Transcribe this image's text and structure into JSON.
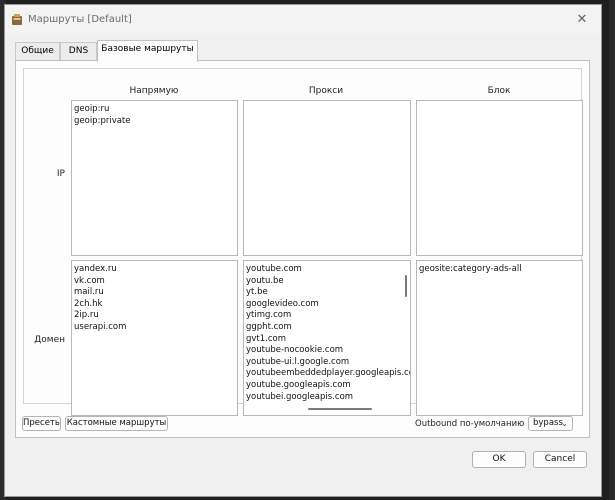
{
  "window": {
    "title": "Маршруты [Default]"
  },
  "tabs": [
    {
      "label": "Общие"
    },
    {
      "label": "DNS"
    },
    {
      "label": "Базовые маршруты"
    }
  ],
  "columns": {
    "direct": "Напрямую",
    "proxy": "Прокси",
    "block": "Блок"
  },
  "rows": {
    "ip": "IP",
    "domain": "Домен"
  },
  "lists": {
    "ip_direct": [
      "geoip:ru",
      "geoip:private"
    ],
    "ip_proxy": [],
    "ip_block": [],
    "domain_direct": [
      "yandex.ru",
      "vk.com",
      "mail.ru",
      "2ch.hk",
      "2ip.ru",
      "userapi.com"
    ],
    "domain_proxy": [
      "youtube.com",
      "youtu.be",
      "yt.be",
      "googlevideo.com",
      "ytimg.com",
      "ggpht.com",
      "gvt1.com",
      "youtube-nocookie.com",
      "youtube-ui.l.google.com",
      "youtubeembeddedplayer.googleapis.com",
      "youtube.googleapis.com",
      "youtubei.googleapis.com"
    ],
    "domain_block": [
      "geosite:category-ads-all"
    ]
  },
  "bottom": {
    "presets_label": "Пресеты",
    "custom_routes_label": "Кастомные маршруты",
    "outbound_label": "Outbound по-умолчанию",
    "outbound_value": "bypass"
  },
  "dialog": {
    "ok_label": "OK",
    "cancel_label": "Cancel"
  },
  "icons": {
    "close": "close-icon",
    "app": "app-icon",
    "dropdown": "chevron-down-icon"
  }
}
